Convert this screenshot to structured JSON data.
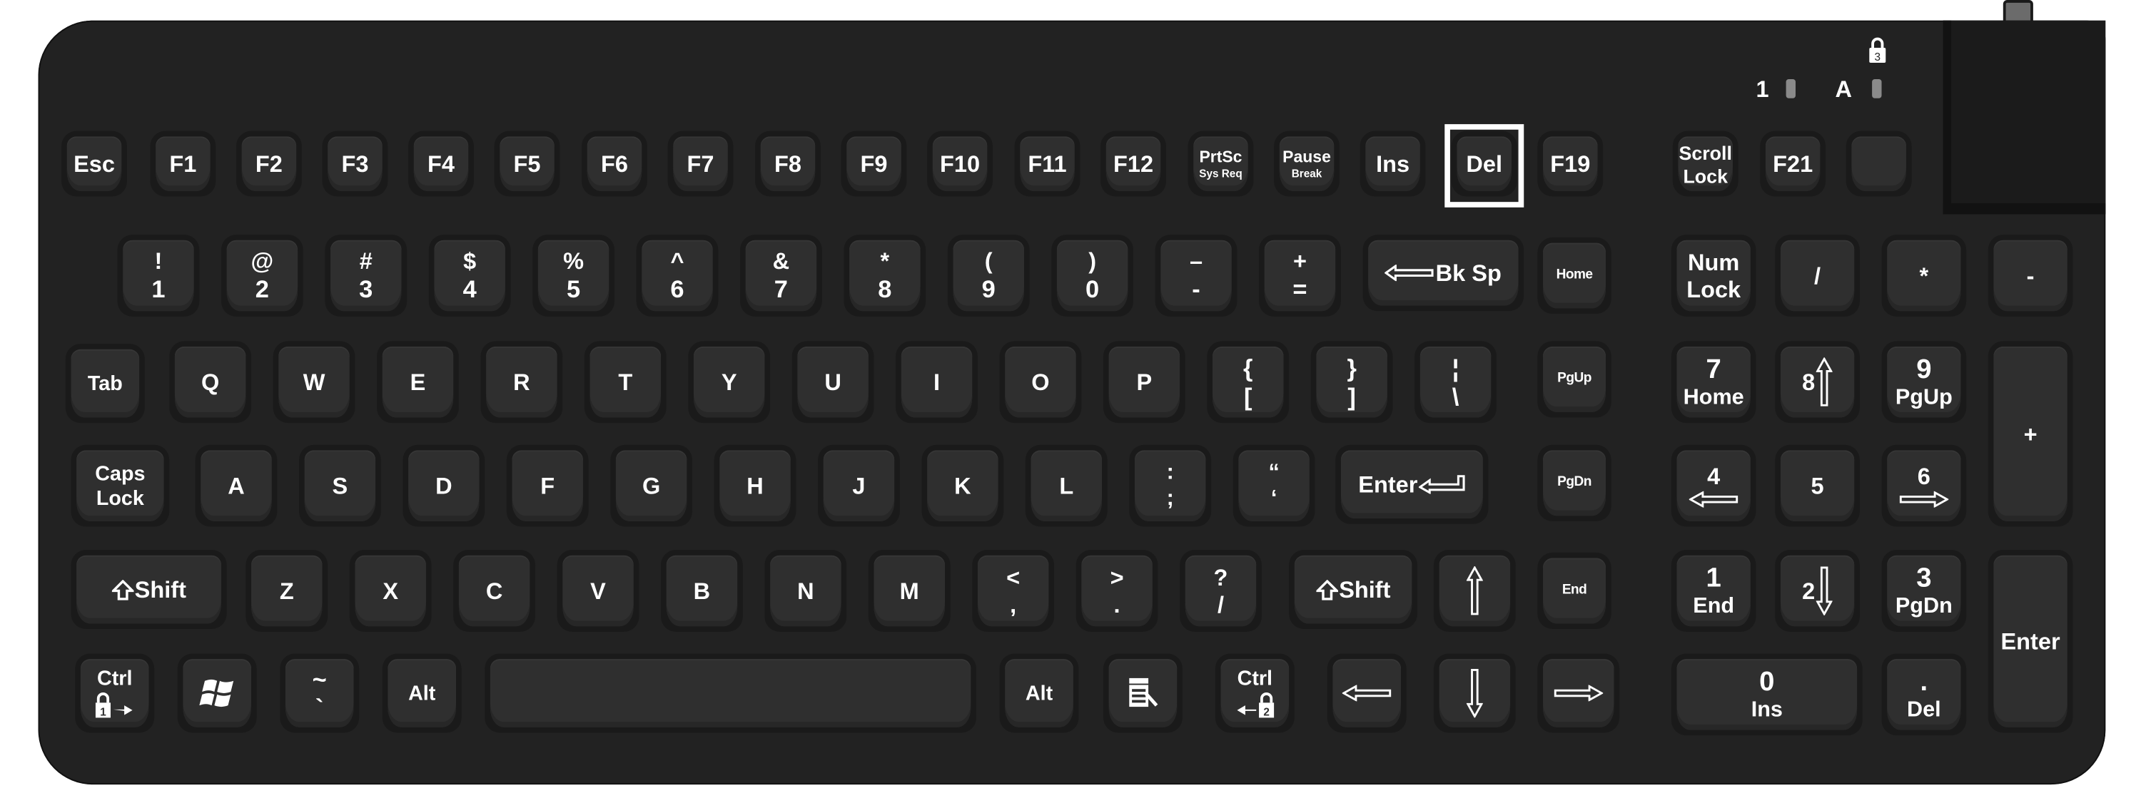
{
  "colors": {
    "body": "#222222",
    "keycap": "#2f2f2f",
    "legend": "#ffffff",
    "highlight": "#ffffff",
    "led": "#8a8a8a"
  },
  "indicators": {
    "num_lock_label": "1",
    "caps_lock_label": "A",
    "scroll_lock_icon": "padlock-3-icon",
    "scroll_lock_number": "3"
  },
  "highlighted_key": "Del",
  "rows": {
    "function": [
      {
        "label": "Esc"
      },
      {
        "label": "F1"
      },
      {
        "label": "F2"
      },
      {
        "label": "F3"
      },
      {
        "label": "F4"
      },
      {
        "label": "F5"
      },
      {
        "label": "F6"
      },
      {
        "label": "F7"
      },
      {
        "label": "F8"
      },
      {
        "label": "F9"
      },
      {
        "label": "F10"
      },
      {
        "label": "F11"
      },
      {
        "label": "F12"
      },
      {
        "top": "PrtSc",
        "bottom": "Sys Req"
      },
      {
        "top": "Pause",
        "bottom": "Break"
      },
      {
        "label": "Ins"
      },
      {
        "label": "Del"
      },
      {
        "label": "F19"
      },
      {
        "top": "Scroll",
        "bottom": "Lock"
      },
      {
        "label": "F21"
      },
      {
        "label": ""
      }
    ],
    "number": [
      {
        "top": "!",
        "bottom": "1"
      },
      {
        "top": "@",
        "bottom": "2"
      },
      {
        "top": "#",
        "bottom": "3"
      },
      {
        "top": "$",
        "bottom": "4"
      },
      {
        "top": "%",
        "bottom": "5"
      },
      {
        "top": "^",
        "bottom": "6"
      },
      {
        "top": "&",
        "bottom": "7"
      },
      {
        "top": "*",
        "bottom": "8"
      },
      {
        "top": "(",
        "bottom": "9"
      },
      {
        "top": ")",
        "bottom": "0"
      },
      {
        "top": "–",
        "bottom": "-"
      },
      {
        "top": "+",
        "bottom": "="
      },
      {
        "label": "Bk Sp",
        "icon": "backspace-arrow-icon"
      },
      {
        "label": "Home"
      }
    ],
    "qwerty": [
      {
        "label": "Tab"
      },
      {
        "label": "Q"
      },
      {
        "label": "W"
      },
      {
        "label": "E"
      },
      {
        "label": "R"
      },
      {
        "label": "T"
      },
      {
        "label": "Y"
      },
      {
        "label": "U"
      },
      {
        "label": "I"
      },
      {
        "label": "O"
      },
      {
        "label": "P"
      },
      {
        "top": "{",
        "bottom": "["
      },
      {
        "top": "}",
        "bottom": "]"
      },
      {
        "top": "¦",
        "bottom": "\\"
      },
      {
        "label": "PgUp"
      }
    ],
    "home": [
      {
        "top": "Caps",
        "bottom": "Lock"
      },
      {
        "label": "A"
      },
      {
        "label": "S"
      },
      {
        "label": "D"
      },
      {
        "label": "F"
      },
      {
        "label": "G"
      },
      {
        "label": "H"
      },
      {
        "label": "J"
      },
      {
        "label": "K"
      },
      {
        "label": "L"
      },
      {
        "top": ":",
        "bottom": ";"
      },
      {
        "top": "“",
        "bottom": "‘"
      },
      {
        "label": "Enter",
        "icon": "enter-arrow-icon"
      },
      {
        "label": "PgDn"
      }
    ],
    "shift": [
      {
        "label": "Shift",
        "icon": "shift-arrow-icon"
      },
      {
        "label": "Z"
      },
      {
        "label": "X"
      },
      {
        "label": "C"
      },
      {
        "label": "V"
      },
      {
        "label": "B"
      },
      {
        "label": "N"
      },
      {
        "label": "M"
      },
      {
        "top": "<",
        "bottom": ","
      },
      {
        "top": ">",
        "bottom": "."
      },
      {
        "top": "?",
        "bottom": "/"
      },
      {
        "label": "Shift",
        "icon": "shift-arrow-icon"
      },
      {
        "label": "",
        "icon": "up-arrow-icon"
      },
      {
        "label": "End"
      }
    ],
    "bottom": [
      {
        "label": "Ctrl",
        "icon": "lock-1-arrow-right-icon",
        "lock_number": "1"
      },
      {
        "label": "",
        "icon": "windows-logo-icon"
      },
      {
        "top": "~",
        "bottom": "`"
      },
      {
        "label": "Alt"
      },
      {
        "label": "",
        "icon": "space-bar"
      },
      {
        "label": "Alt"
      },
      {
        "label": "",
        "icon": "menu-key-icon"
      },
      {
        "label": "Ctrl",
        "icon": "lock-2-arrow-left-icon",
        "lock_number": "2"
      },
      {
        "label": "",
        "icon": "left-arrow-icon"
      },
      {
        "label": "",
        "icon": "down-arrow-icon"
      },
      {
        "label": "",
        "icon": "right-arrow-icon"
      }
    ]
  },
  "numpad": {
    "num_lock": {
      "top": "Num",
      "bottom": "Lock"
    },
    "divide": "/",
    "multiply": "*",
    "minus": "-",
    "plus": "+",
    "enter": "Enter",
    "k7": {
      "top": "7",
      "bottom": "Home"
    },
    "k8": {
      "top": "8",
      "icon": "up-arrow-icon"
    },
    "k9": {
      "top": "9",
      "bottom": "PgUp"
    },
    "k4": {
      "top": "4",
      "icon": "left-arrow-icon"
    },
    "k5": {
      "top": "5"
    },
    "k6": {
      "top": "6",
      "icon": "right-arrow-icon"
    },
    "k1": {
      "top": "1",
      "bottom": "End"
    },
    "k2": {
      "top": "2",
      "icon": "down-arrow-icon"
    },
    "k3": {
      "top": "3",
      "bottom": "PgDn"
    },
    "k0": {
      "top": "0",
      "bottom": "Ins"
    },
    "dot": {
      "top": ".",
      "bottom": "Del"
    }
  }
}
